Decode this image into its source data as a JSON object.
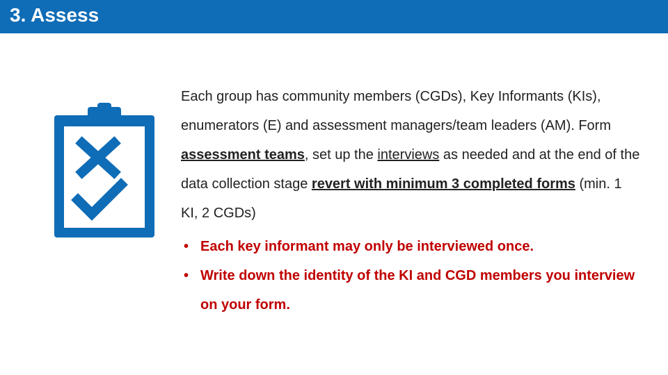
{
  "title": "3. Assess",
  "paragraph": {
    "seg1": "Each group has community members (CGDs), Key Informants (KIs), enumerators (E) and assessment managers/team leaders (AM). Form ",
    "seg2_bu": "assessment teams",
    "seg3": ", set up the ",
    "seg4_u": "interviews",
    "seg5": " as needed and at the end of the data collection stage ",
    "seg6_bu": "revert with minimum 3 completed forms",
    "seg7": " (min. 1 KI, 2 CGDs)"
  },
  "bullets": [
    "Each key informant may only be interviewed once.",
    "Write down the identity of the KI and CGD members you interview on your form."
  ],
  "colors": {
    "brand": "#0f6cb6",
    "accent": "#c00000"
  },
  "icon": "clipboard-check-x-icon"
}
